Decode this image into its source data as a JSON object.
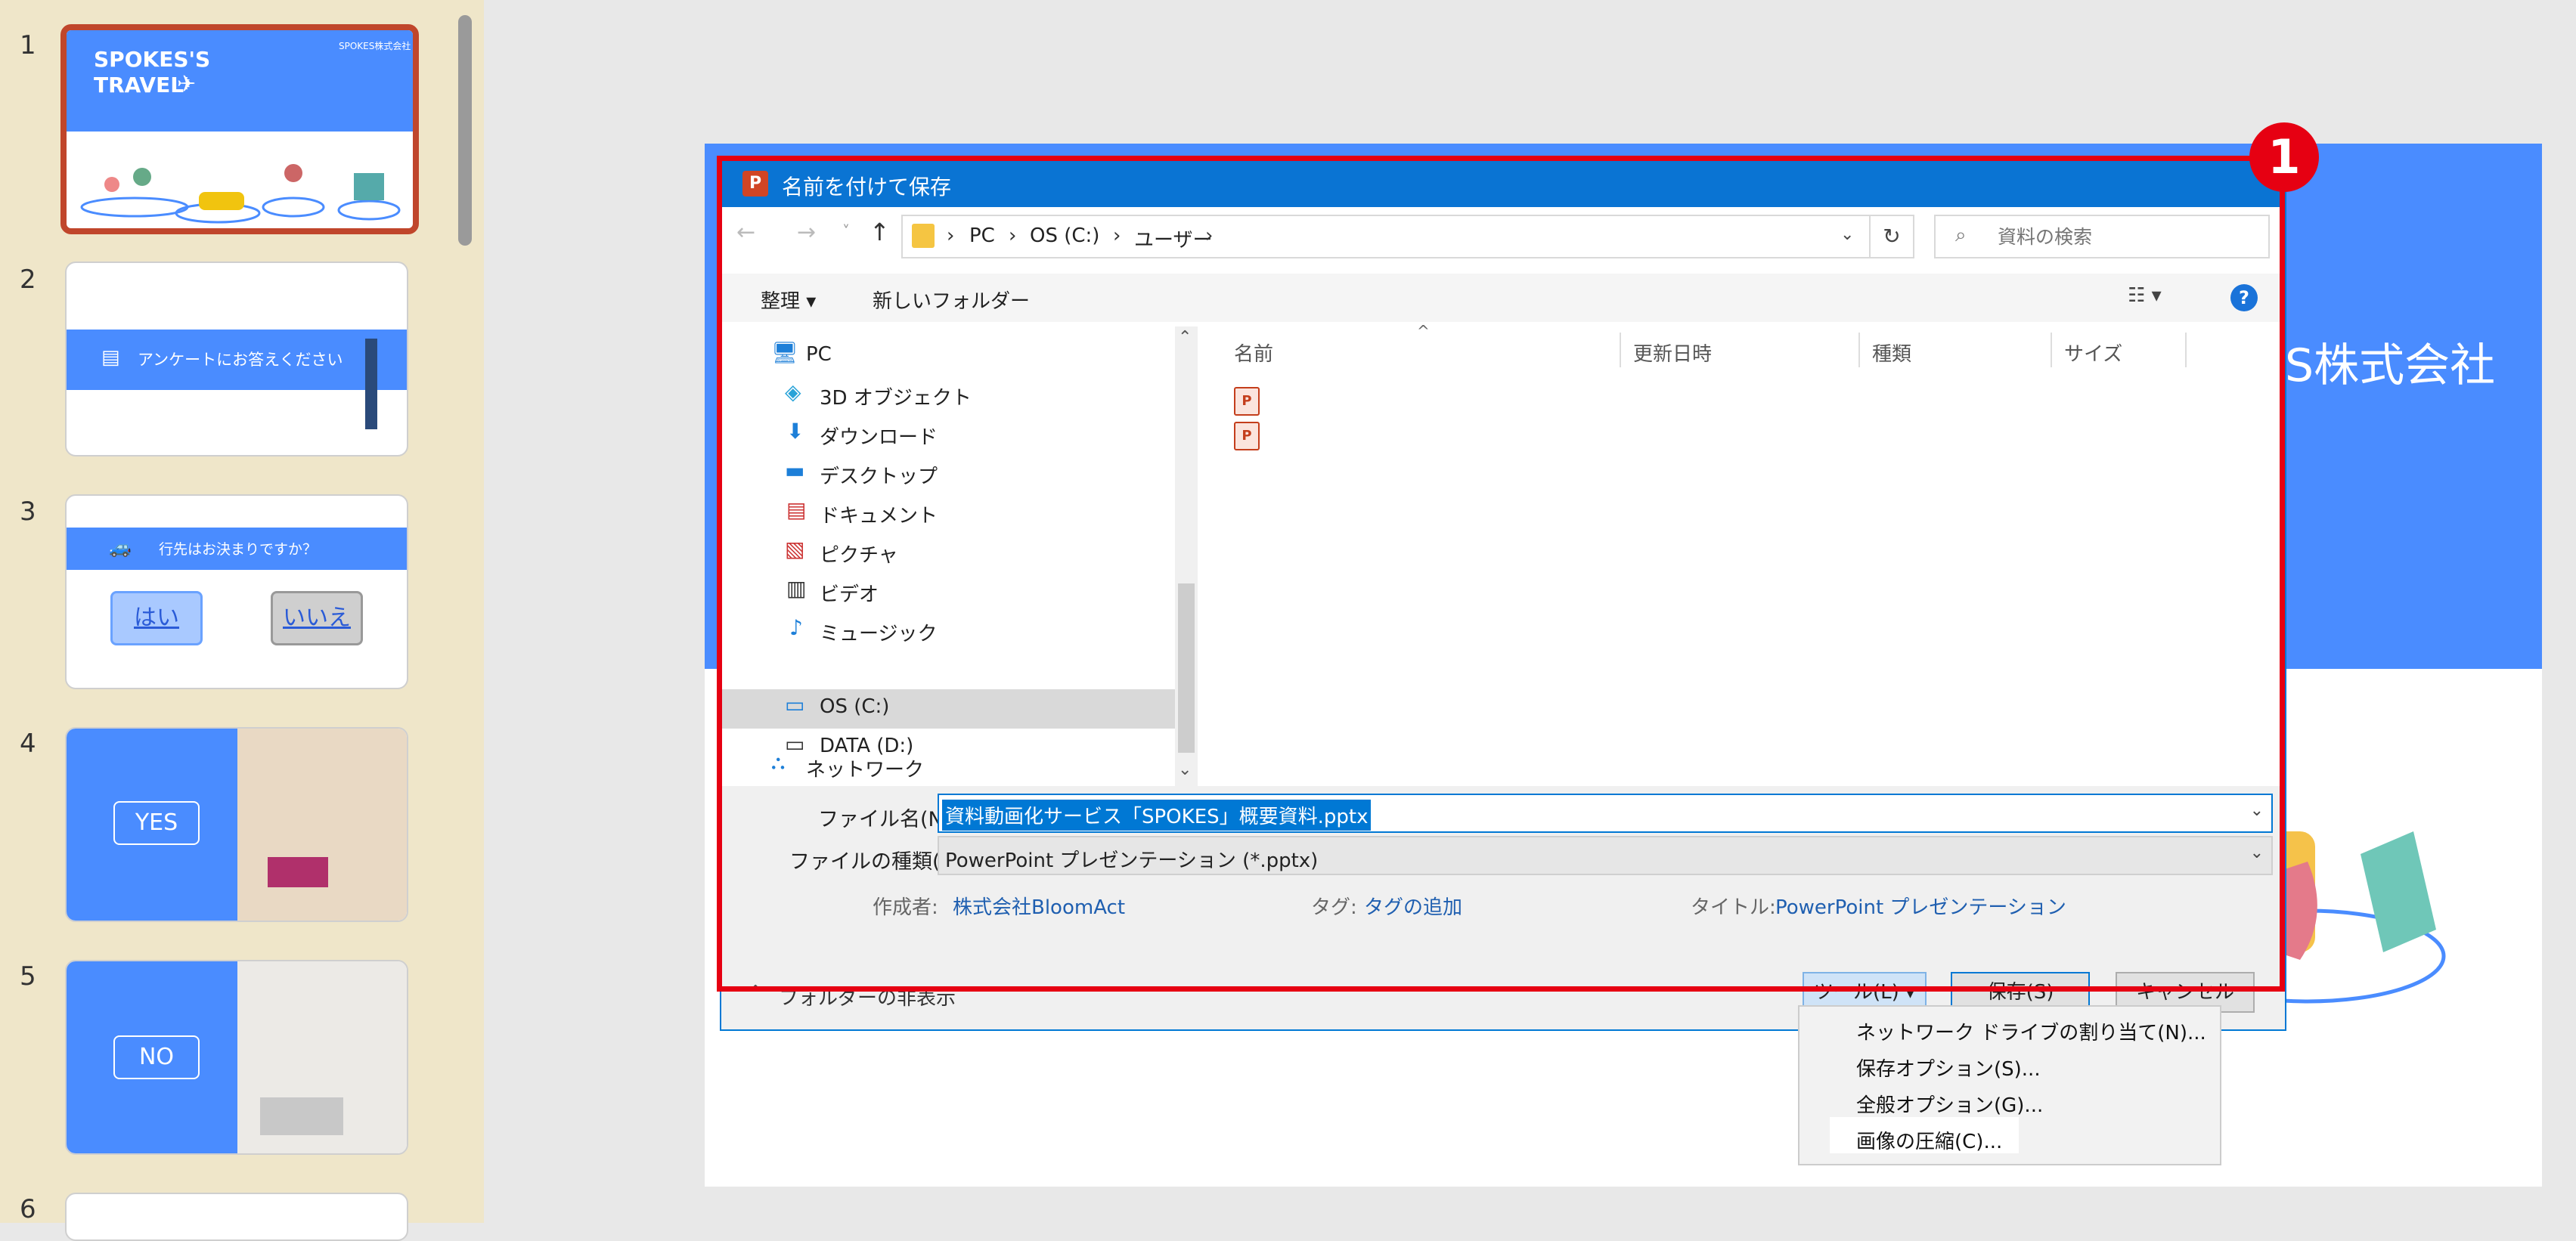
{
  "slides": [
    {
      "number": "1",
      "title_line1": "SPOKES'S",
      "title_line2": "TRAVEL",
      "brand": "SPOKES株式会社"
    },
    {
      "number": "2",
      "banner": "アンケートにお答えください"
    },
    {
      "number": "3",
      "question": "行先はお決まりですか？",
      "yes": "はい",
      "no": "いいえ"
    },
    {
      "number": "4",
      "label": "YES"
    },
    {
      "number": "5",
      "label": "NO"
    },
    {
      "number": "6"
    }
  ],
  "main_slide": {
    "company_text": "S株式会社"
  },
  "callout": {
    "number": "1"
  },
  "dialog": {
    "title": "名前を付けて保存",
    "breadcrumb": [
      "PC",
      "OS (C:)",
      "ユーザー"
    ],
    "search_placeholder": "資料の検索",
    "organize": "整理 ▾",
    "new_folder": "新しいフォルダー",
    "nav_items": [
      "PC",
      "3D オブジェクト",
      "ダウンロード",
      "デスクトップ",
      "ドキュメント",
      "ピクチャ",
      "ビデオ",
      "ミュージック",
      "OS (C:)",
      "DATA (D:)",
      "ネットワーク"
    ],
    "columns": [
      "名前",
      "更新日時",
      "種類",
      "サイズ"
    ],
    "filename_label": "ファイル名(N):",
    "filename_value": "資料動画化サービス「SPOKES」概要資料.pptx",
    "filetype_label": "ファイルの種類(T):",
    "filetype_value": "PowerPoint プレゼンテーション (*.pptx)",
    "author_label": "作成者:",
    "author_value": "株式会社BloomAct",
    "tags_label": "タグ:",
    "tags_value": "タグの追加",
    "title_label": "タイトル:",
    "title_value": "PowerPoint プレゼンテーション",
    "hide_folders": "フォルダーの非表示",
    "tools": "ツール(L)",
    "save": "保存(S)",
    "cancel": "キャンセル"
  },
  "tools_menu": [
    "ネットワーク ドライブの割り当て(N)...",
    "保存オプション(S)...",
    "全般オプション(G)...",
    "画像の圧縮(C)..."
  ]
}
